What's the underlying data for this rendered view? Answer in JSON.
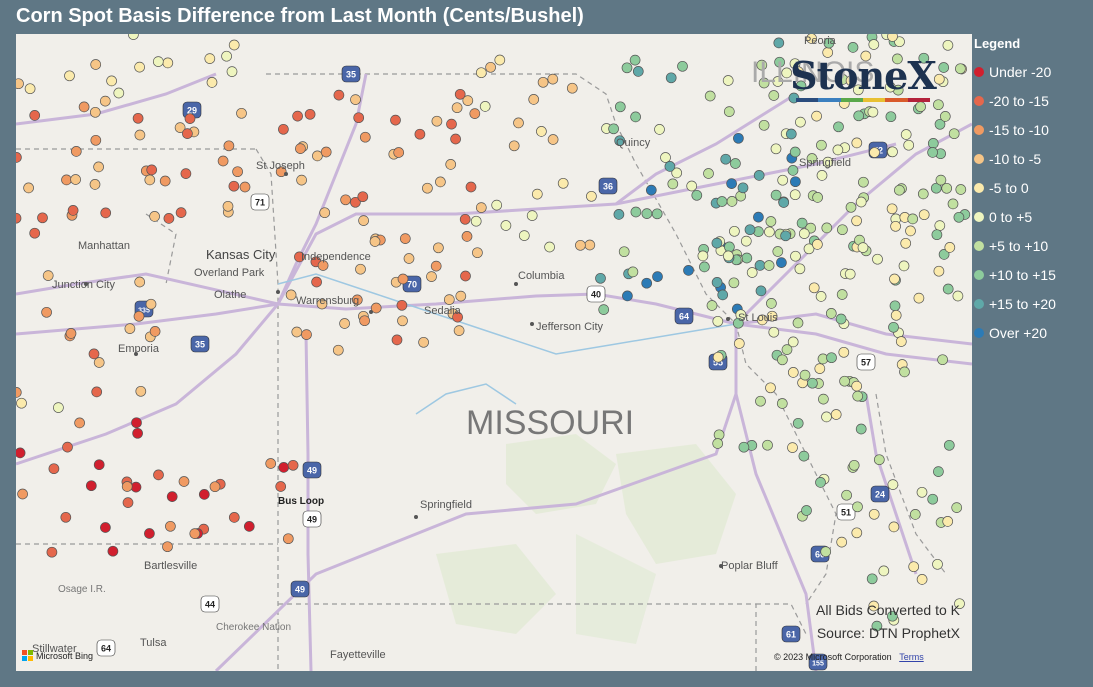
{
  "title": "Corn Spot Basis Difference from Last Month (Cents/Bushel)",
  "legend": {
    "title": "Legend",
    "items": [
      {
        "label": "Under -20",
        "color": "#d11f2e"
      },
      {
        "label": "-20 to -15",
        "color": "#e5674c"
      },
      {
        "label": "-15 to -10",
        "color": "#f09a62"
      },
      {
        "label": "-10 to -5",
        "color": "#f6c587"
      },
      {
        "label": "-5 to 0",
        "color": "#fbeaac"
      },
      {
        "label": "0 to +5",
        "color": "#eef5bf"
      },
      {
        "label": "+5 to +10",
        "color": "#c1e0a0"
      },
      {
        "label": "+10 to +15",
        "color": "#8dcb9c"
      },
      {
        "label": "+15 to +20",
        "color": "#5fa8a8"
      },
      {
        "label": "Over +20",
        "color": "#2c7bb6"
      }
    ]
  },
  "map": {
    "labels": {
      "missouri": "MISSOURI",
      "illinois": "ILLINOIS",
      "kansas_city": "Kansas City",
      "st_joseph": "St Joseph",
      "independence": "Independence",
      "overland_park": "Overland Park",
      "olathe": "Olathe",
      "warrensburg": "Warrensburg",
      "sedalia": "Sedalia",
      "columbia": "Columbia",
      "jefferson_city": "Jefferson City",
      "st_louis": "St Louis",
      "springfield_il": "Springfield",
      "springfield_mo": "Springfield",
      "manhattan": "Manhattan",
      "junction_city": "Junction City",
      "emporia": "Emporia",
      "bartlesville": "Bartlesville",
      "osage": "Osage I.R.",
      "cherokee": "Cherokee Nation",
      "tulsa": "Tulsa",
      "stillwater": "Stillwater",
      "fayetteville": "Fayetteville",
      "poplar_bluff": "Poplar Bluff",
      "bus_loop": "Bus Loop",
      "peoria": "Peoria",
      "quincy": "Quincy"
    },
    "shields": [
      "29",
      "35",
      "71",
      "36",
      "70",
      "40",
      "64",
      "55",
      "57",
      "72",
      "24",
      "51",
      "60",
      "49",
      "44",
      "335",
      "35",
      "49",
      "49",
      "61",
      "64",
      "155"
    ]
  },
  "brand": {
    "name": "StoneX",
    "bar_colors": [
      "#2a4c7d",
      "#3a7fbf",
      "#5aa84b",
      "#e8c032",
      "#d95a2b",
      "#b3223a"
    ]
  },
  "notes": {
    "line1": "All Bids Converted to K",
    "line2": "Source: DTN ProphetX"
  },
  "footer": {
    "bing": "Microsoft Bing",
    "copyright": "© 2023 Microsoft Corporation",
    "terms": "Terms"
  }
}
